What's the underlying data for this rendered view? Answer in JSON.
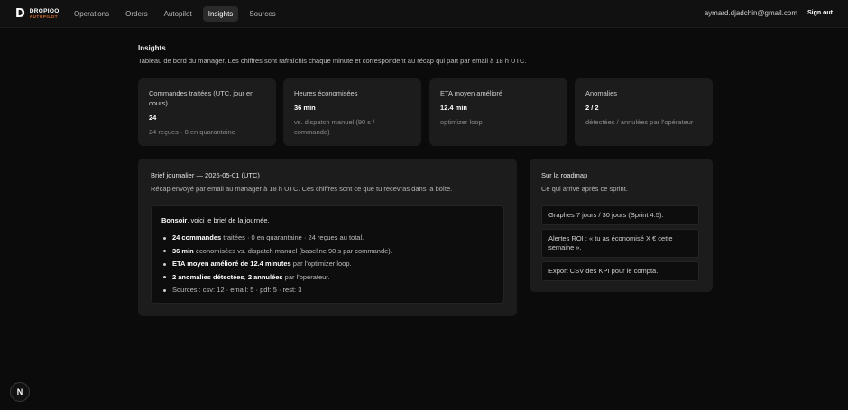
{
  "brand": {
    "mark": "D",
    "name": "DROPIOO",
    "sub": "AUTOPILOT"
  },
  "nav": {
    "items": [
      "Operations",
      "Orders",
      "Autopilot",
      "Insights",
      "Sources"
    ],
    "active": "Insights"
  },
  "user": {
    "email": "aymard.djadchin@gmail.com",
    "signout": "Sign out"
  },
  "header": {
    "title": "Insights",
    "description": "Tableau de bord du manager. Les chiffres sont rafraîchis chaque minute et correspondent au récap qui part par email à 18 h UTC."
  },
  "stats": [
    {
      "label": "Commandes traitées (UTC, jour en cours)",
      "value": "24",
      "sub": "24 reçues · 0 en quarantaine"
    },
    {
      "label": "Heures économisées",
      "value": "36 min",
      "sub": "vs. dispatch manuel (90 s / commande)"
    },
    {
      "label": "ETA moyen amélioré",
      "value": "12.4 min",
      "sub": "optimizer loop"
    },
    {
      "label": "Anomalies",
      "value": "2 / 2",
      "sub": "détectées / annulées par l'opérateur"
    }
  ],
  "brief": {
    "title": "Brief journalier — 2026-05-01 (UTC)",
    "description": "Récap envoyé par email au manager à 18 h UTC. Ces chiffres sont ce que tu recevras dans la boîte.",
    "greeting_bold": "Bonsoir",
    "greeting_rest": ", voici le brief de la journée.",
    "items": [
      {
        "bold": "24 commandes",
        "rest": " traitées · 0 en quarantaine · 24 reçues au total."
      },
      {
        "bold": "36 min",
        "rest": " économisées vs. dispatch manuel (baseline 90 s par commande)."
      },
      {
        "bold": "ETA moyen amélioré de 12.4 minutes",
        "rest": " par l'optimizer loop."
      },
      {
        "bold": "2 anomalies détectées",
        "rest": ", "
      },
      {
        "bold": "",
        "rest": "Sources : csv: 12 · email: 5 · pdf: 5 · rest: 3"
      }
    ],
    "anomaly_bold2": "2 annulées",
    "anomaly_rest2": " par l'opérateur."
  },
  "roadmap": {
    "title": "Sur la roadmap",
    "description": "Ce qui arrive après ce sprint.",
    "items": [
      "Graphes 7 jours / 30 jours (Sprint 4.5).",
      "Alertes ROI : « tu as économisé X € cette semaine ».",
      "Export CSV des KPI pour le compta."
    ]
  },
  "badge": {
    "letter": "N"
  }
}
